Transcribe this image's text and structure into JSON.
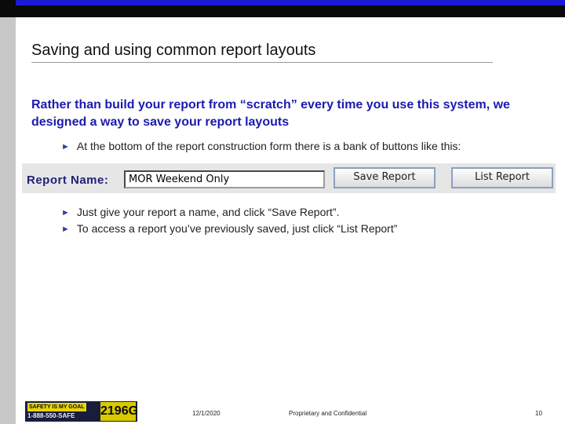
{
  "slide": {
    "title": "Saving and using common report layouts",
    "lead": "Rather than build your report from “scratch” every time you use this system, we designed a way to save your report layouts",
    "bullets": [
      "At the bottom of the report construction form there is a bank of buttons like this:",
      "Just give your report a name, and click “Save Report”.",
      "To access a report you’ve previously saved, just click “List Report”"
    ],
    "bullet_icon": "right-triangle-icon"
  },
  "report_panel": {
    "label": "Report Name:",
    "input_value": "MOR Weekend Only",
    "save_button": "Save Report",
    "list_button": "List Report"
  },
  "logo": {
    "line1": "SAFETY IS MY GOAL",
    "line2": "1-888-550-SAFE",
    "code": "2196G"
  },
  "footer": {
    "date": "12/1/2020",
    "confidential": "Proprietary and Confidential",
    "page": "10"
  },
  "colors": {
    "top_bar": "#0a0a0a",
    "accent_blue": "#1b1bd6",
    "lead_text": "#1a1ab0",
    "left_strip": "#c7c7c7"
  }
}
